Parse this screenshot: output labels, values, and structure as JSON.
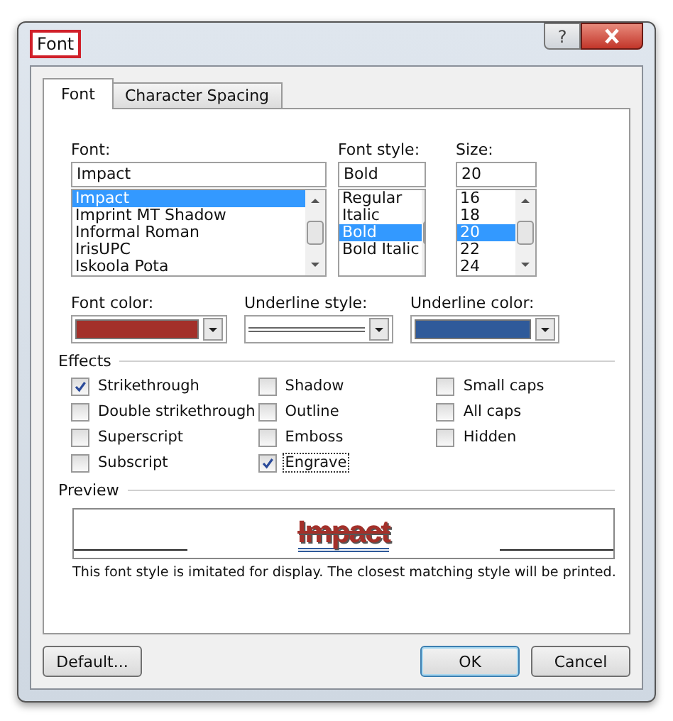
{
  "window": {
    "title": "Font",
    "help": "?"
  },
  "tabs": [
    {
      "label": "Font",
      "selected": true
    },
    {
      "label": "Character Spacing",
      "selected": false
    }
  ],
  "lists": [
    {
      "label": "Font:",
      "value": "Impact",
      "items": [
        {
          "label": "Impact",
          "selected": true
        },
        {
          "label": "Imprint MT Shadow",
          "selected": false
        },
        {
          "label": "Informal Roman",
          "selected": false
        },
        {
          "label": "IrisUPC",
          "selected": false
        },
        {
          "label": "Iskoola Pota",
          "selected": false
        }
      ]
    },
    {
      "label": "Font style:",
      "value": "Bold",
      "items": [
        {
          "label": "Regular",
          "selected": false
        },
        {
          "label": "Italic",
          "selected": false
        },
        {
          "label": "Bold",
          "selected": true
        },
        {
          "label": "Bold Italic",
          "selected": false
        }
      ]
    },
    {
      "label": "Size:",
      "value": "20",
      "items": [
        {
          "label": "16",
          "selected": false
        },
        {
          "label": "18",
          "selected": false
        },
        {
          "label": "20",
          "selected": true
        },
        {
          "label": "22",
          "selected": false
        },
        {
          "label": "24",
          "selected": false
        }
      ]
    }
  ],
  "dropdowns": [
    {
      "label": "Font color:",
      "kind": "color",
      "color": "#a3302a"
    },
    {
      "label": "Underline style:",
      "kind": "line"
    },
    {
      "label": "Underline color:",
      "kind": "color",
      "color": "#2f5a9a"
    }
  ],
  "effects": {
    "title": "Effects",
    "columns": [
      [
        {
          "label": "Strikethrough",
          "checked": true,
          "focused": false
        },
        {
          "label": "Double strikethrough",
          "checked": false,
          "focused": false
        },
        {
          "label": "Superscript",
          "checked": false,
          "focused": false
        },
        {
          "label": "Subscript",
          "checked": false,
          "focused": false
        }
      ],
      [
        {
          "label": "Shadow",
          "checked": false,
          "focused": false
        },
        {
          "label": "Outline",
          "checked": false,
          "focused": false
        },
        {
          "label": "Emboss",
          "checked": false,
          "focused": false
        },
        {
          "label": "Engrave",
          "checked": true,
          "focused": true
        }
      ],
      [
        {
          "label": "Small caps",
          "checked": false,
          "focused": false
        },
        {
          "label": "All caps",
          "checked": false,
          "focused": false
        },
        {
          "label": "Hidden",
          "checked": false,
          "focused": false
        }
      ]
    ]
  },
  "preview": {
    "title": "Preview",
    "sample": "Impact",
    "note": "This font style is imitated for display. The closest matching style will be printed."
  },
  "buttons": [
    {
      "label": "Default...",
      "default": false
    },
    {
      "label": "OK",
      "default": true
    },
    {
      "label": "Cancel",
      "default": false
    }
  ]
}
